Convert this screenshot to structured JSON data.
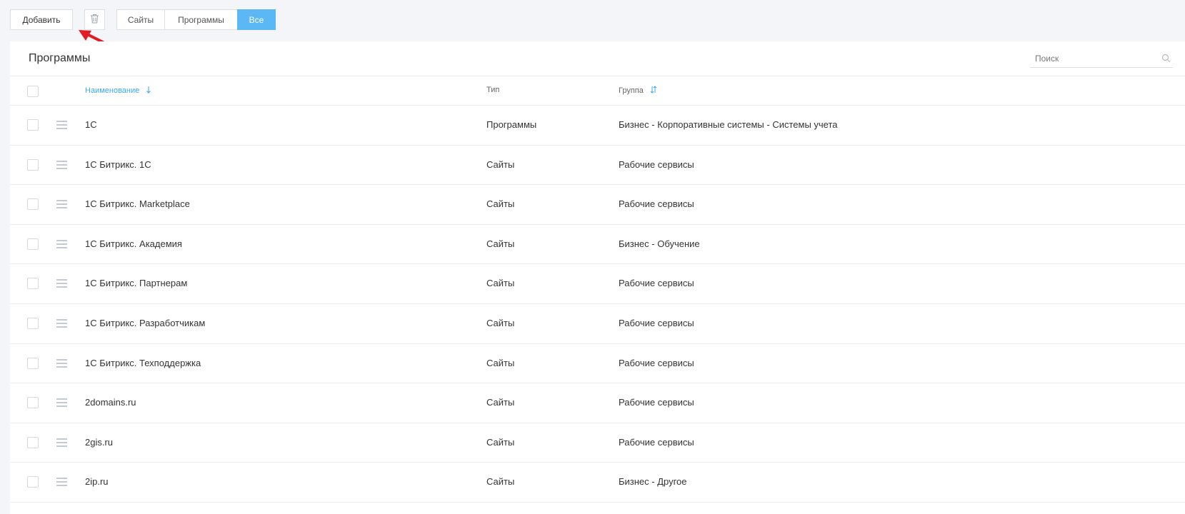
{
  "toolbar": {
    "add_label": "Добавить",
    "filters": [
      {
        "label": "Сайты",
        "active": false
      },
      {
        "label": "Программы",
        "active": false
      },
      {
        "label": "Все",
        "active": true
      }
    ]
  },
  "panel": {
    "title": "Программы",
    "search_placeholder": "Поиск"
  },
  "table": {
    "headers": {
      "name": "Наименование",
      "type": "Тип",
      "group": "Группа"
    },
    "rows": [
      {
        "name": "1С",
        "type": "Программы",
        "group": "Бизнес - Корпоративные системы - Системы учета"
      },
      {
        "name": "1С Битрикс. 1С",
        "type": "Сайты",
        "group": "Рабочие сервисы"
      },
      {
        "name": "1С Битрикс. Marketplace",
        "type": "Сайты",
        "group": "Рабочие сервисы"
      },
      {
        "name": "1С Битрикс. Академия",
        "type": "Сайты",
        "group": "Бизнес - Обучение"
      },
      {
        "name": "1С Битрикс. Партнерам",
        "type": "Сайты",
        "group": "Рабочие сервисы"
      },
      {
        "name": "1С Битрикс. Разработчикам",
        "type": "Сайты",
        "group": "Рабочие сервисы"
      },
      {
        "name": "1С Битрикс. Техподдержка",
        "type": "Сайты",
        "group": "Рабочие сервисы"
      },
      {
        "name": "2domains.ru",
        "type": "Сайты",
        "group": "Рабочие сервисы"
      },
      {
        "name": "2gis.ru",
        "type": "Сайты",
        "group": "Рабочие сервисы"
      },
      {
        "name": "2ip.ru",
        "type": "Сайты",
        "group": "Бизнес - Другое"
      }
    ]
  },
  "colors": {
    "accent": "#5bb8f5",
    "link": "#3da9f0",
    "annotation_arrow": "#e31b23"
  },
  "icons": {
    "delete": "trash-icon",
    "search": "search-icon",
    "drag": "drag-handle-icon",
    "sort_name": "sort-down-icon",
    "sort_group": "sort-both-icon"
  }
}
